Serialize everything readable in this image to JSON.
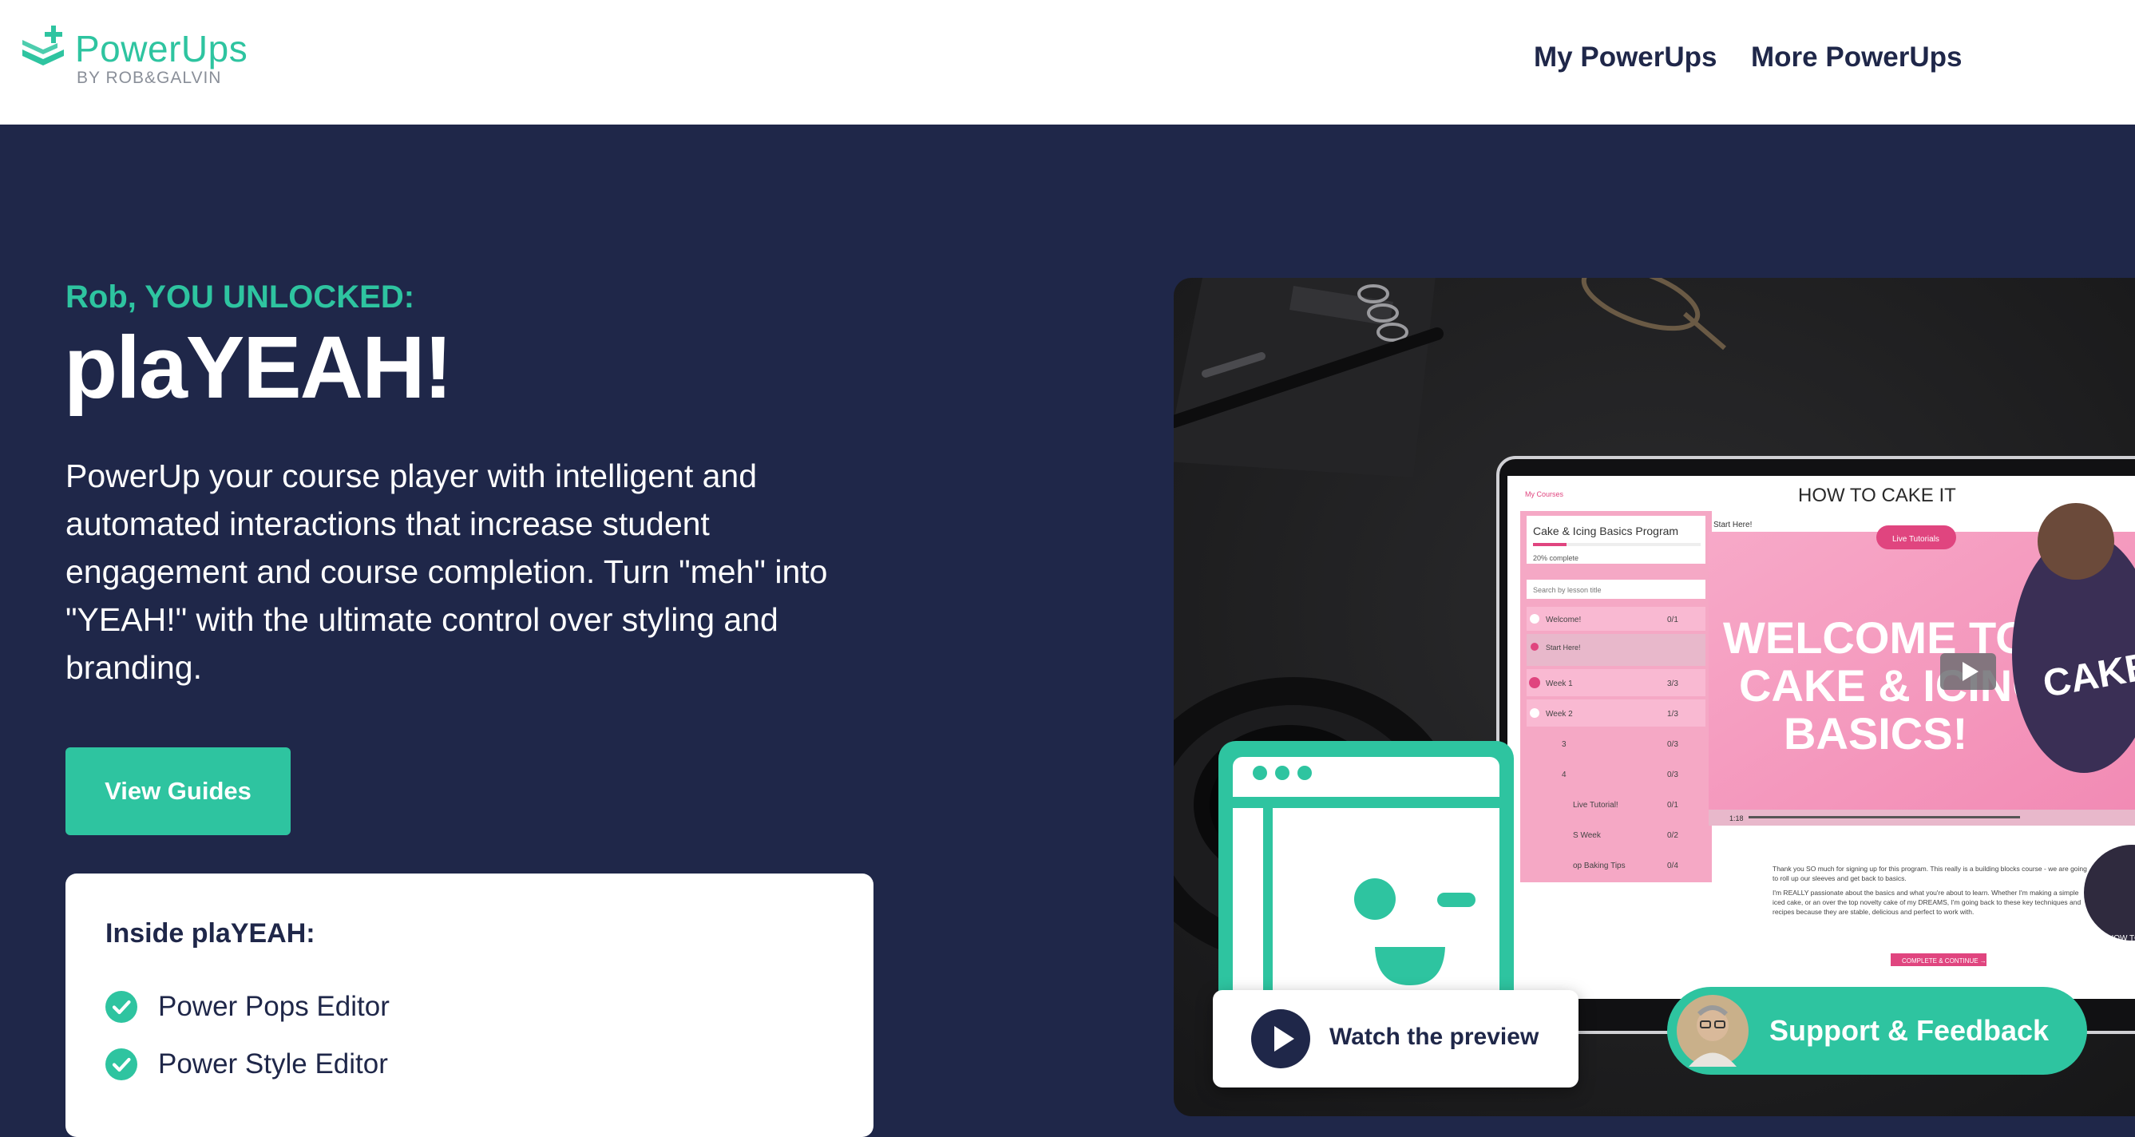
{
  "brand": {
    "name": "PowerUps",
    "byline": "BY ROB&GALVIN",
    "accent": "#2ec4a0",
    "navy": "#1f2749"
  },
  "nav": {
    "my_powerups": "My PowerUps",
    "more_powerups": "More PowerUps"
  },
  "hero": {
    "eyebrow": "Rob, YOU UNLOCKED:",
    "title": "plaYEAH!",
    "description": "PowerUp your course player with intelligent and automated interactions that increase student engagement and course completion. Turn \"meh\" into \"YEAH!\" with the ultimate control over styling and branding.",
    "cta_label": "View Guides"
  },
  "inside": {
    "title": "Inside plaYEAH:",
    "items": [
      {
        "label": "Power Pops Editor",
        "icon": "check-circle-icon"
      },
      {
        "label": "Power Style Editor",
        "icon": "check-circle-icon"
      }
    ]
  },
  "preview": {
    "brand_logo": "HOW TO CAKE IT",
    "back_link": "My Courses",
    "course_title": "Cake & Icing Basics Program",
    "progress_label": "20% complete",
    "progress_value": 0.2,
    "search_placeholder": "Search by lesson title",
    "lessons": [
      {
        "title": "Welcome!",
        "count": "0/1"
      },
      {
        "title": "Start Here!",
        "count": ""
      },
      {
        "title": "Week 1",
        "count": "3/3"
      },
      {
        "title": "Week 2",
        "count": "1/3"
      },
      {
        "title": "3",
        "count": "0/3"
      },
      {
        "title": "4",
        "count": "0/3"
      },
      {
        "title": "Live Tutorial!",
        "count": "0/1"
      },
      {
        "title": "S Week",
        "count": "0/2"
      },
      {
        "title": "op Baking Tips",
        "count": "0/4"
      }
    ],
    "video_header": "Start Here!",
    "live_badge": "Live Tutorials",
    "video_text_1": "WELCOME TO",
    "video_text_2": "CAKE & ICING",
    "video_text_3": "BASICS!",
    "shirt_text": "CAKE",
    "time_label": "1:18",
    "body_1": "Thank you SO much for signing up for this program. This really is a building blocks course - we are going to roll up our sleeves and get back to basics.",
    "body_2": "I'm REALLY passionate about the basics and what you're about to learn. Whether I'm making a simple iced cake, or an over the top novelty cake of my DREAMS, I'm going back to these key techniques and recipes because they are stable, delicious and perfect to work with.",
    "complete_label": "COMPLETE & CONTINUE →",
    "mini_logo": "HOW TO CAKE IT",
    "watch_label": "Watch the preview"
  },
  "support": {
    "label": "Support & Feedback"
  }
}
